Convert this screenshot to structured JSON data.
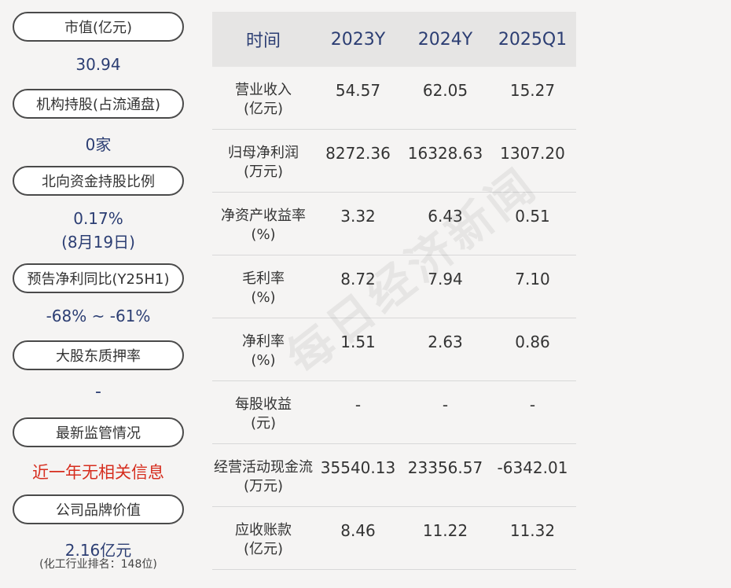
{
  "left": {
    "items": [
      {
        "label": "市值(亿元)",
        "value": "30.94"
      },
      {
        "label": "机构持股(占流通盘)",
        "value": "0家"
      },
      {
        "label": "北向资金持股比例",
        "value": "0.17%",
        "value2": "(8月19日)"
      },
      {
        "label": "预告净利同比(Y25H1)",
        "value": "-68% ~ -61%"
      },
      {
        "label": "大股东质押率",
        "value": "-"
      },
      {
        "label": "最新监管情况",
        "value": "近一年无相关信息"
      },
      {
        "label": "公司品牌价值",
        "value": "2.16亿元",
        "note": "(化工行业排名：148位)"
      }
    ],
    "colors": {
      "value": "#2c3e73",
      "alert": "#d62d1e"
    }
  },
  "table": {
    "headers": [
      "时间",
      "2023Y",
      "2024Y",
      "2025Q1"
    ],
    "rows": [
      {
        "name": "营业收入",
        "unit": "(亿元)",
        "values": [
          "54.57",
          "62.05",
          "15.27"
        ]
      },
      {
        "name": "归母净利润",
        "unit": "(万元)",
        "values": [
          "8272.36",
          "16328.63",
          "1307.20"
        ]
      },
      {
        "name": "净资产收益率",
        "unit": "(%)",
        "values": [
          "3.32",
          "6.43",
          "0.51"
        ]
      },
      {
        "name": "毛利率",
        "unit": "(%)",
        "values": [
          "8.72",
          "7.94",
          "7.10"
        ]
      },
      {
        "name": "净利率",
        "unit": "(%)",
        "values": [
          "1.51",
          "2.63",
          "0.86"
        ]
      },
      {
        "name": "每股收益",
        "unit": "(元)",
        "values": [
          "-",
          "-",
          "-"
        ]
      },
      {
        "name": "经营活动现金流",
        "unit": "(万元)",
        "values": [
          "35540.13",
          "23356.57",
          "-6342.01"
        ]
      },
      {
        "name": "应收账款",
        "unit": "(亿元)",
        "values": [
          "8.46",
          "11.22",
          "11.32"
        ]
      }
    ]
  },
  "watermark": "每日经济新闻"
}
